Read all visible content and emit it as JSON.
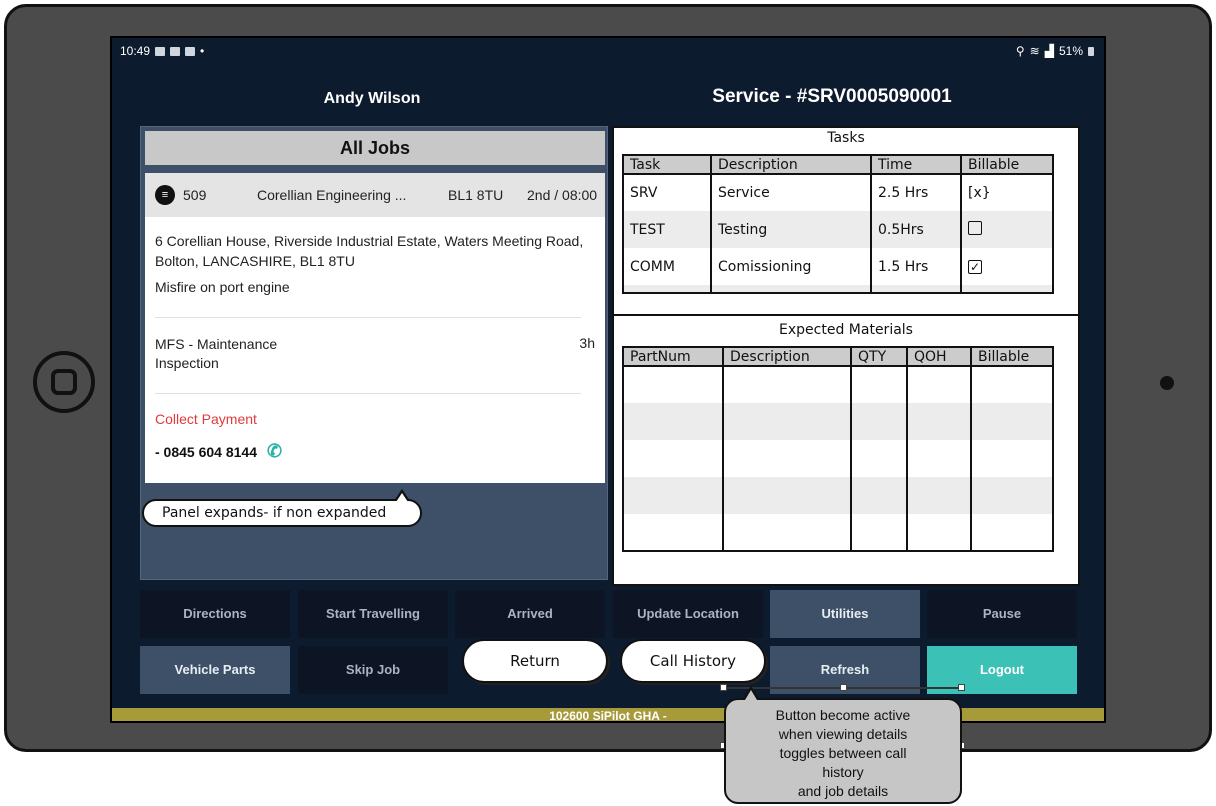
{
  "status_bar": {
    "time": "10:49",
    "dot": "•",
    "battery": "51%"
  },
  "header": {
    "technician": "Andy Wilson",
    "service": "Service - #SRV0005090001"
  },
  "left_panel": {
    "title": "All Jobs",
    "job": {
      "number": "509",
      "company": "Corellian Engineering ...",
      "postcode": "BL1 8TU",
      "slot": "2nd / 08:00",
      "address": "6 Corellian House, Riverside Industrial Estate, Waters Meeting Road, Bolton, LANCASHIRE, BL1 8TU",
      "fault": "Misfire on port engine",
      "job_type": "MFS - Maintenance Inspection",
      "duration": "3h",
      "collect_label": "Collect Payment",
      "phone": "- 0845 604 8144"
    }
  },
  "annotations": {
    "panel_expands": "Panel expands- if non expanded",
    "call_history_note": [
      "Button become active",
      "when viewing details",
      "toggles between call",
      "history",
      "and job details"
    ]
  },
  "tasks": {
    "title": "Tasks",
    "columns": [
      "Task",
      "Description",
      "Time",
      "Billable"
    ],
    "rows": [
      {
        "task": "SRV",
        "description": "Service",
        "time": "2.5 Hrs",
        "billable": "[x}"
      },
      {
        "task": "TEST",
        "description": "Testing",
        "time": "0.5Hrs",
        "billable": ""
      },
      {
        "task": "COMM",
        "description": "Comissioning",
        "time": "1.5 Hrs",
        "billable": "✓"
      }
    ]
  },
  "materials": {
    "title": "Expected Materials",
    "columns": [
      "PartNum",
      "Description",
      "QTY",
      "QOH",
      "Billable"
    ],
    "row_count": 5
  },
  "buttons": {
    "directions": "Directions",
    "start_travelling": "Start Travelling",
    "arrived": "Arrived",
    "update_location": "Update Location",
    "utilities": "Utilities",
    "pause": "Pause",
    "vehicle_parts": "Vehicle Parts",
    "skip_job": "Skip Job",
    "return": "Return",
    "call_history": "Call History",
    "refresh": "Refresh",
    "logout": "Logout"
  },
  "footer": "102600 SiPilot GHA -",
  "colors": {
    "screen_bg": "#0d1b2e",
    "panel_bg": "#3d5068",
    "logout_teal": "#3cc1b7",
    "collect_red": "#e03a3a",
    "footer_gold": "#a79a3a"
  },
  "icons": [
    "home-button-icon",
    "camera-icon",
    "job-icon",
    "phone-icon"
  ]
}
